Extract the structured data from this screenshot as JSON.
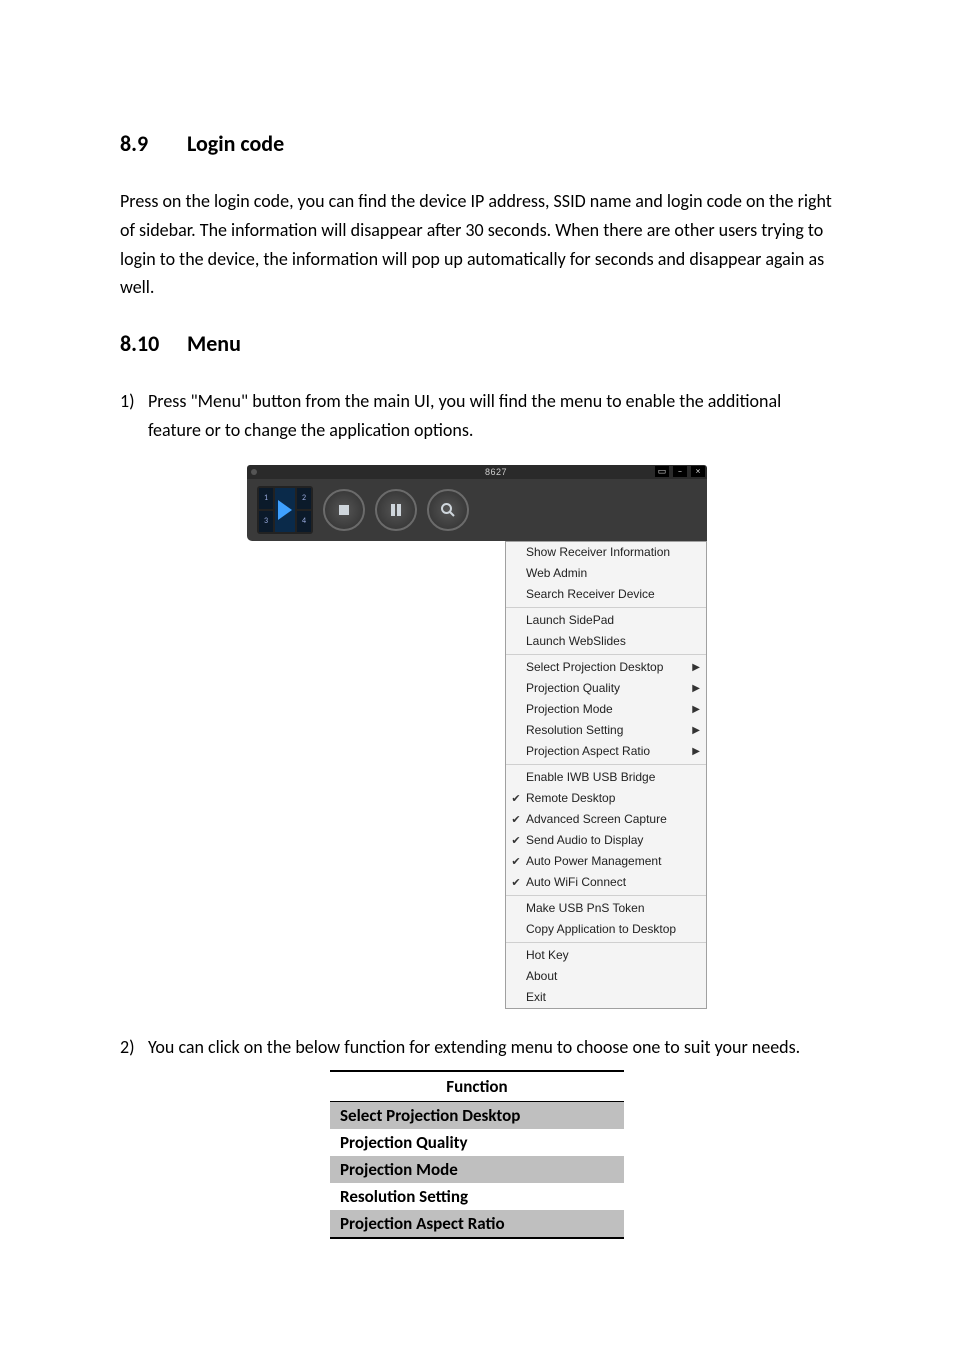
{
  "sections": {
    "s89": {
      "num": "8.9",
      "title": "Login code"
    },
    "s810": {
      "num": "8.10",
      "title": "Menu"
    }
  },
  "paragraphs": {
    "p1": "Press on the login code, you can find the device IP address, SSID name and login code on the right of sidebar. The information will disappear after 30 seconds. When there are other users trying to login to the device, the information will pop up automatically for seconds and disappear again as well."
  },
  "list": {
    "item1marker": "1)",
    "item1": "Press \"Menu\" button from the main UI, you will find the menu to enable the additional feature or to change the application options.",
    "item2marker": "2)",
    "item2": "You can click on the below function for extending menu to choose one to suit your needs."
  },
  "screenshot": {
    "titlebar_code": "8627",
    "quad": {
      "c1": "1",
      "c2": "2",
      "c3": "3",
      "c4": "4"
    },
    "minimize": "–",
    "close": "×",
    "menu_box": "▭",
    "menu_groups": [
      [
        {
          "label": "Show Receiver Information",
          "checked": false,
          "submenu": false
        },
        {
          "label": "Web Admin",
          "checked": false,
          "submenu": false
        },
        {
          "label": "Search Receiver Device",
          "checked": false,
          "submenu": false
        }
      ],
      [
        {
          "label": "Launch SidePad",
          "checked": false,
          "submenu": false
        },
        {
          "label": "Launch WebSlides",
          "checked": false,
          "submenu": false
        }
      ],
      [
        {
          "label": "Select Projection Desktop",
          "checked": false,
          "submenu": true
        },
        {
          "label": "Projection Quality",
          "checked": false,
          "submenu": true
        },
        {
          "label": "Projection Mode",
          "checked": false,
          "submenu": true
        },
        {
          "label": "Resolution Setting",
          "checked": false,
          "submenu": true
        },
        {
          "label": "Projection Aspect Ratio",
          "checked": false,
          "submenu": true
        }
      ],
      [
        {
          "label": "Enable IWB USB Bridge",
          "checked": false,
          "submenu": false
        },
        {
          "label": "Remote Desktop",
          "checked": true,
          "submenu": false
        },
        {
          "label": "Advanced Screen Capture",
          "checked": true,
          "submenu": false
        },
        {
          "label": "Send Audio to Display",
          "checked": true,
          "submenu": false
        },
        {
          "label": "Auto Power Management",
          "checked": true,
          "submenu": false
        },
        {
          "label": "Auto WiFi Connect",
          "checked": true,
          "submenu": false
        }
      ],
      [
        {
          "label": "Make USB PnS Token",
          "checked": false,
          "submenu": false
        },
        {
          "label": "Copy Application to Desktop",
          "checked": false,
          "submenu": false
        }
      ],
      [
        {
          "label": "Hot Key",
          "checked": false,
          "submenu": false
        },
        {
          "label": "About",
          "checked": false,
          "submenu": false
        },
        {
          "label": "Exit",
          "checked": false,
          "submenu": false
        }
      ]
    ]
  },
  "function_table": {
    "header": "Function",
    "rows": [
      {
        "label": "Select Projection Desktop",
        "shaded": true
      },
      {
        "label": "Projection Quality",
        "shaded": false
      },
      {
        "label": "Projection Mode",
        "shaded": true
      },
      {
        "label": "Resolution Setting",
        "shaded": false
      },
      {
        "label": "Projection Aspect Ratio",
        "shaded": true
      }
    ]
  }
}
